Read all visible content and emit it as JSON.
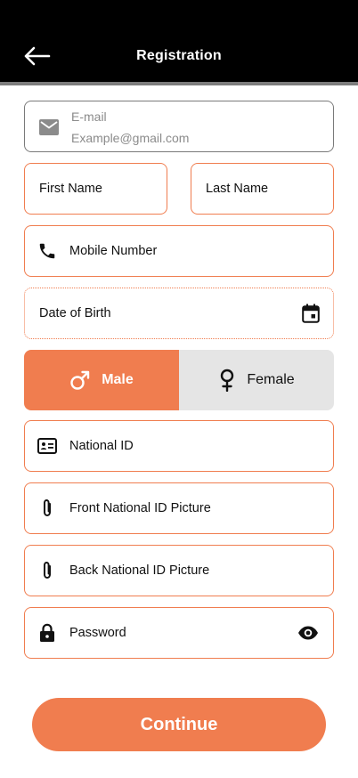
{
  "header": {
    "title": "Registration",
    "back_icon": "arrow-left-icon"
  },
  "form": {
    "email": {
      "label": "E-mail",
      "placeholder": "Example@gmail.com",
      "icon": "mail-icon"
    },
    "first_name": {
      "label": "First Name"
    },
    "last_name": {
      "label": "Last Name"
    },
    "mobile": {
      "label": "Mobile Number",
      "icon": "phone-icon"
    },
    "dob": {
      "label": "Date of Birth",
      "icon": "calendar-icon"
    },
    "gender": {
      "selected": "Male",
      "male_label": "Male",
      "female_label": "Female"
    },
    "national_id": {
      "label": "National ID",
      "icon": "id-card-icon"
    },
    "front_id": {
      "label": "Front National ID Picture",
      "icon": "paperclip-icon"
    },
    "back_id": {
      "label": "Back National ID Picture",
      "icon": "paperclip-icon"
    },
    "password": {
      "label": "Password",
      "icon": "lock-icon",
      "toggle_icon": "eye-icon"
    }
  },
  "actions": {
    "continue_label": "Continue"
  },
  "colors": {
    "accent": "#f07d4f",
    "header_bg": "#000000",
    "unselected_bg": "#e5e5e5"
  }
}
